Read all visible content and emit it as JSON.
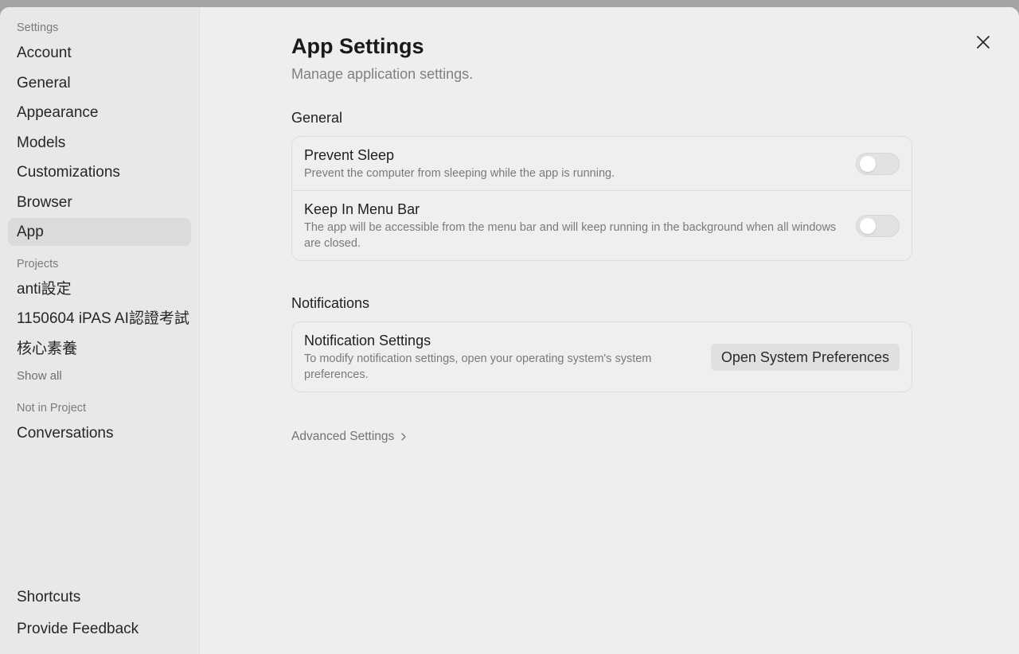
{
  "sidebar": {
    "settings_label": "Settings",
    "items": [
      {
        "label": "Account"
      },
      {
        "label": "General"
      },
      {
        "label": "Appearance"
      },
      {
        "label": "Models"
      },
      {
        "label": "Customizations"
      },
      {
        "label": "Browser"
      },
      {
        "label": "App",
        "active": true
      }
    ],
    "projects_label": "Projects",
    "projects": [
      {
        "label": "anti設定"
      },
      {
        "label": "1150604 iPAS AI認證考試"
      },
      {
        "label": "核心素養"
      }
    ],
    "show_all": "Show all",
    "not_in_project_label": "Not in Project",
    "conversations": "Conversations",
    "shortcuts": "Shortcuts",
    "feedback": "Provide Feedback"
  },
  "header": {
    "title": "App Settings",
    "subtitle": "Manage application settings."
  },
  "general": {
    "title": "General",
    "prevent_sleep": {
      "title": "Prevent Sleep",
      "description": "Prevent the computer from sleeping while the app is running.",
      "enabled": false
    },
    "keep_in_menu_bar": {
      "title": "Keep In Menu Bar",
      "description": "The app will be accessible from the menu bar and will keep running in the background when all windows are closed.",
      "enabled": false
    }
  },
  "notifications": {
    "title": "Notifications",
    "settings_title": "Notification Settings",
    "settings_description": "To modify notification settings, open your operating system's system preferences.",
    "button_label": "Open System Preferences"
  },
  "advanced": {
    "label": "Advanced Settings"
  },
  "icons": {
    "close": "close-icon",
    "chevron": "chevron-right-icon"
  }
}
